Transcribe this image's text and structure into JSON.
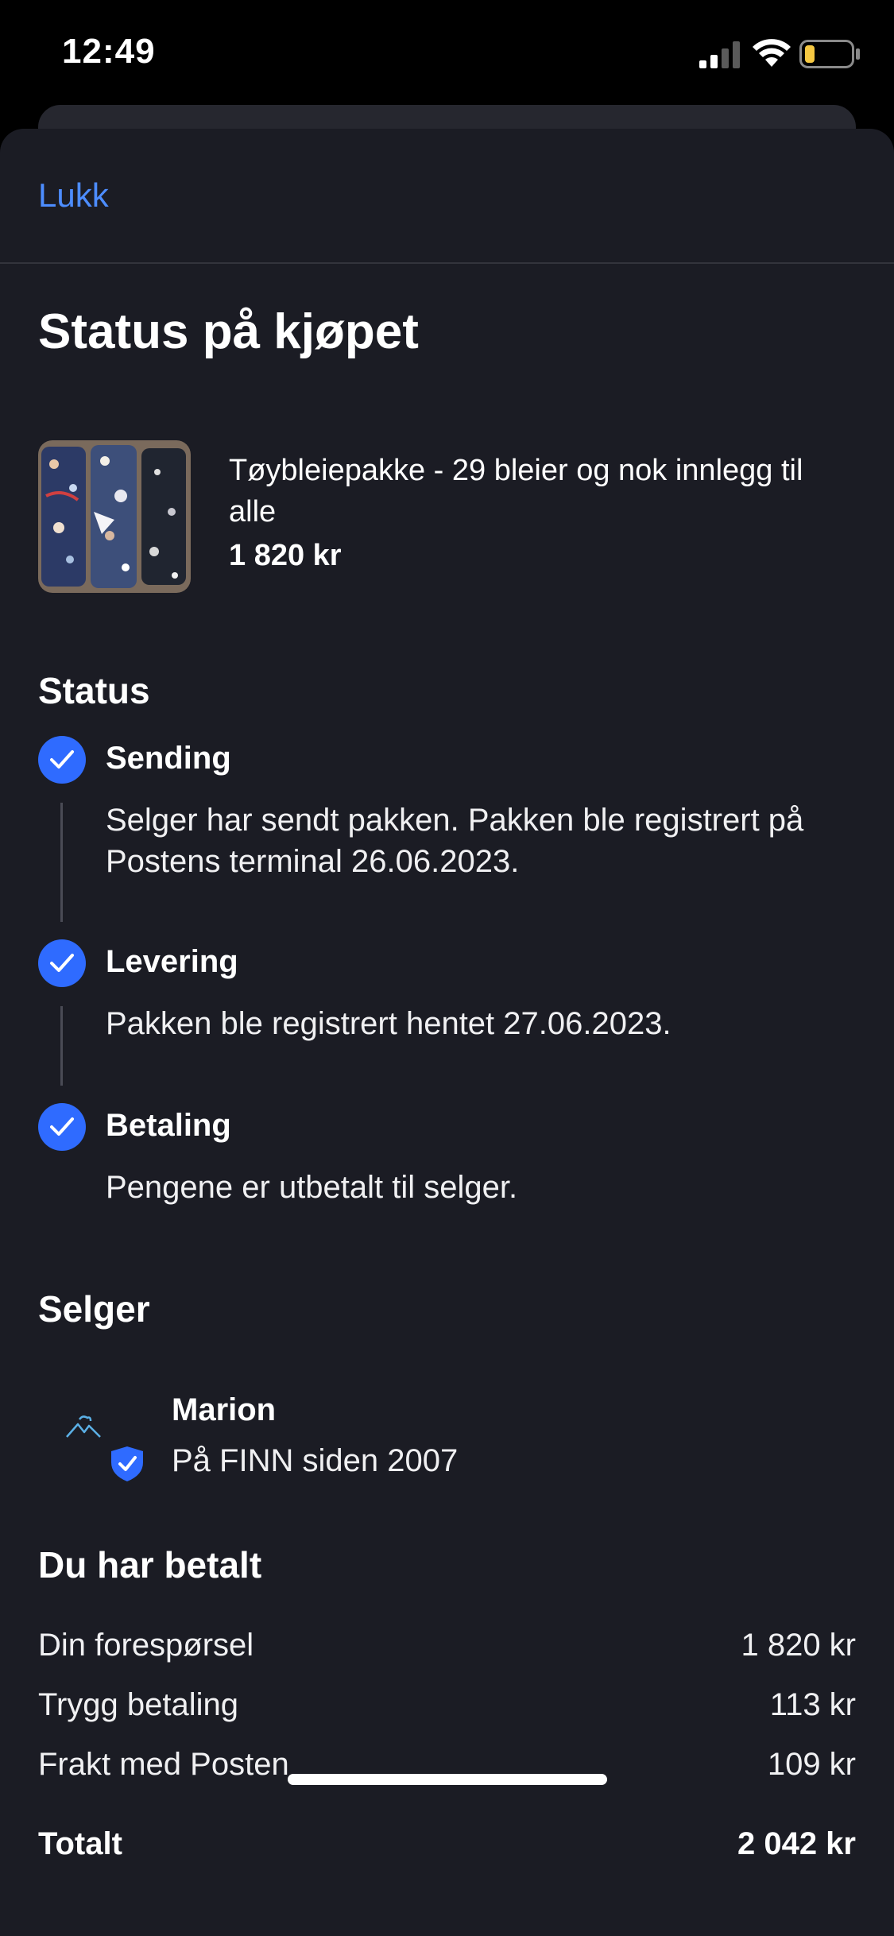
{
  "status_bar": {
    "time": "12:49"
  },
  "header": {
    "close_label": "Lukk",
    "title": "Status på kjøpet"
  },
  "product": {
    "title": "Tøybleiepakke - 29 bleier og nok innlegg til alle",
    "price": "1 820 kr"
  },
  "status": {
    "heading": "Status",
    "steps": [
      {
        "title": "Sending",
        "description": "Selger har sendt pakken. Pakken ble registrert på Postens terminal 26.06.2023."
      },
      {
        "title": "Levering",
        "description": "Pakken ble registrert hentet 27.06.2023."
      },
      {
        "title": "Betaling",
        "description": "Pengene er utbetalt til selger."
      }
    ]
  },
  "seller": {
    "heading": "Selger",
    "name": "Marion",
    "member_since": "På FINN siden 2007"
  },
  "payment": {
    "heading": "Du har betalt",
    "rows": [
      {
        "label": "Din forespørsel",
        "value": "1 820 kr"
      },
      {
        "label": "Trygg betaling",
        "value": "113 kr"
      },
      {
        "label": "Frakt med Posten",
        "value": "109 kr"
      }
    ],
    "total_label": "Totalt",
    "total_value": "2 042 kr"
  },
  "colors": {
    "accent_link": "#4d8dff",
    "check_blue": "#2f6bff",
    "sheet_background": "#1b1c24",
    "battery_low": "#f5c842"
  },
  "icons": [
    "signal-icon",
    "wifi-icon",
    "battery-icon",
    "checkmark-icon",
    "seller-avatar-icon",
    "verified-shield-icon"
  ]
}
